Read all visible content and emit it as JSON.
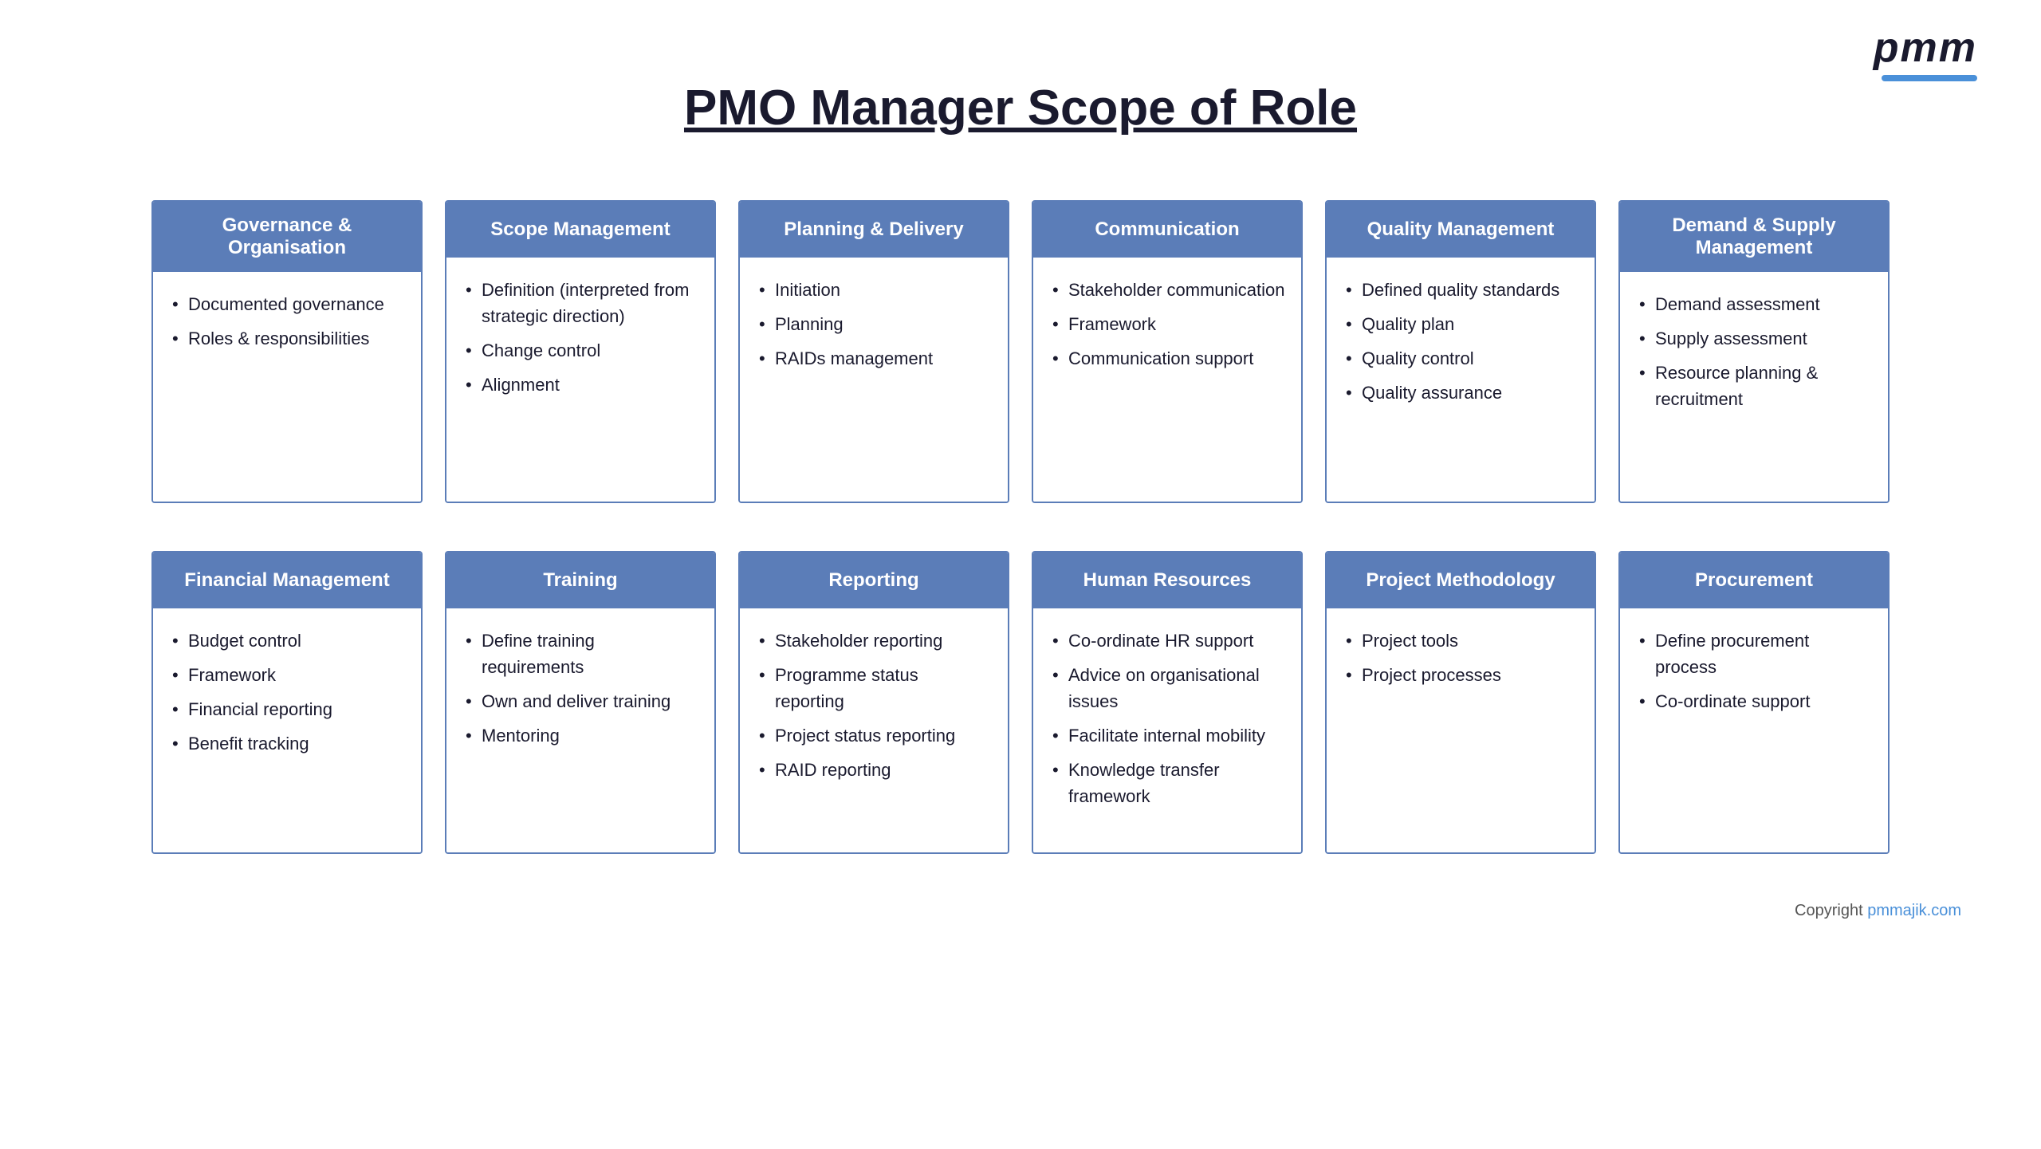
{
  "logo": {
    "text": "pmm",
    "underline": true
  },
  "title": "PMO Manager Scope of Role",
  "row1": [
    {
      "id": "governance",
      "header": "Governance & Organisation",
      "items": [
        "Documented governance",
        "Roles & responsibilities"
      ]
    },
    {
      "id": "scope",
      "header": "Scope Management",
      "items": [
        "Definition (interpreted from strategic direction)",
        "Change control",
        "Alignment"
      ]
    },
    {
      "id": "planning",
      "header": "Planning & Delivery",
      "items": [
        "Initiation",
        "Planning",
        "RAIDs management"
      ]
    },
    {
      "id": "communication",
      "header": "Communication",
      "items": [
        "Stakeholder communication",
        "Framework",
        "Communication support"
      ]
    },
    {
      "id": "quality",
      "header": "Quality Management",
      "items": [
        "Defined quality standards",
        "Quality plan",
        "Quality control",
        "Quality assurance"
      ]
    },
    {
      "id": "demand",
      "header": "Demand & Supply Management",
      "items": [
        "Demand assessment",
        "Supply assessment",
        "Resource planning & recruitment"
      ]
    }
  ],
  "row2": [
    {
      "id": "financial",
      "header": "Financial Management",
      "items": [
        "Budget control",
        "Framework",
        "Financial reporting",
        "Benefit tracking"
      ]
    },
    {
      "id": "training",
      "header": "Training",
      "items": [
        "Define training requirements",
        "Own and deliver training",
        "Mentoring"
      ]
    },
    {
      "id": "reporting",
      "header": "Reporting",
      "items": [
        "Stakeholder reporting",
        "Programme status reporting",
        "Project status reporting",
        "RAID reporting"
      ]
    },
    {
      "id": "hr",
      "header": "Human Resources",
      "items": [
        "Co-ordinate HR support",
        "Advice on organisational issues",
        "Facilitate internal mobility",
        "Knowledge transfer framework"
      ]
    },
    {
      "id": "methodology",
      "header": "Project Methodology",
      "items": [
        "Project tools",
        "Project processes"
      ]
    },
    {
      "id": "procurement",
      "header": "Procurement",
      "items": [
        "Define procurement process",
        "Co-ordinate support"
      ]
    }
  ],
  "copyright": {
    "text": "Copyright ",
    "link_text": "pmmajik.com",
    "link_url": "#"
  }
}
